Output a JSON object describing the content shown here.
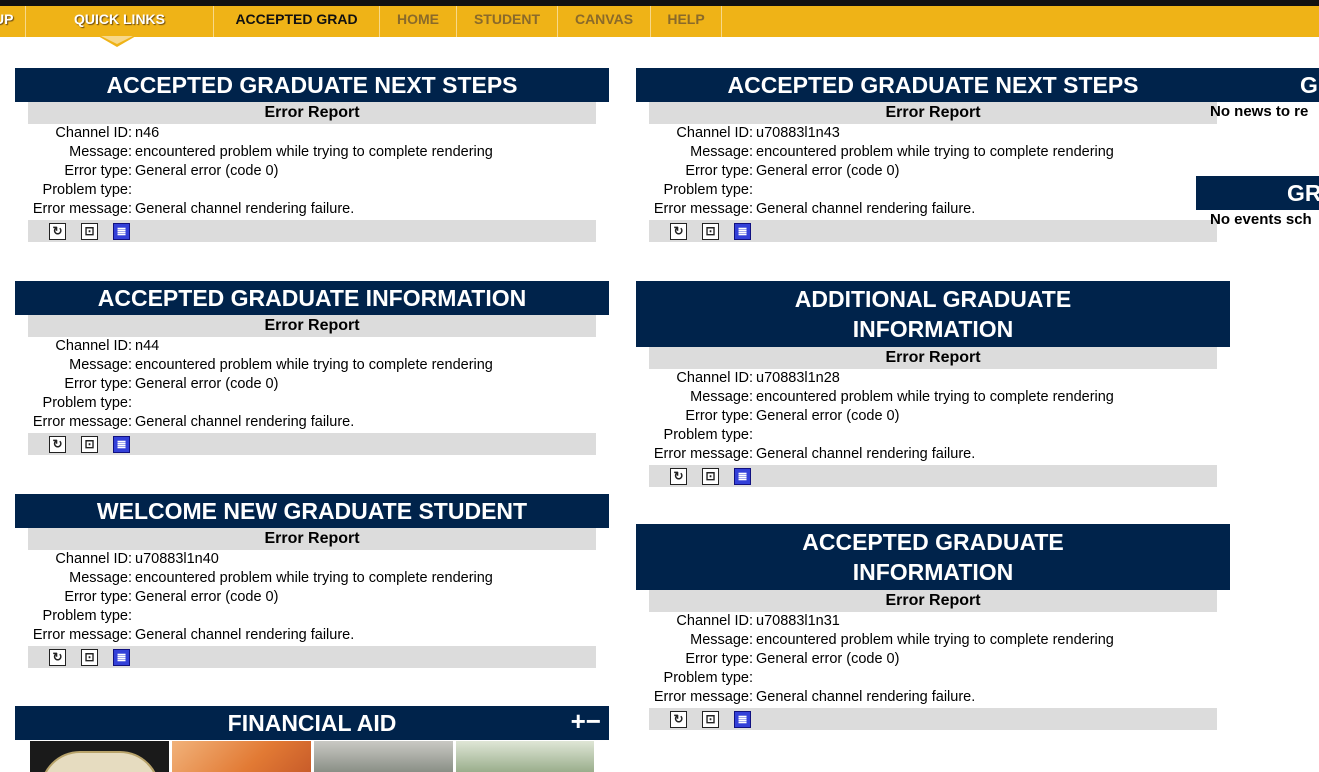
{
  "nav": {
    "items": [
      {
        "label": "UP"
      },
      {
        "label": "QUICK LINKS"
      },
      {
        "label": "ACCEPTED GRAD"
      },
      {
        "label": "HOME"
      },
      {
        "label": "STUDENT"
      },
      {
        "label": "CANVAS"
      },
      {
        "label": "HELP"
      }
    ]
  },
  "error_report_label": "Error Report",
  "field_labels": {
    "channel_id": "Channel ID:",
    "message": "Message:",
    "error_type": "Error type:",
    "problem_type": "Problem type:",
    "error_message": "Error message:"
  },
  "portlets": [
    {
      "title": "ACCEPTED GRADUATE NEXT STEPS",
      "channel_id": "n46",
      "message": "encountered problem while trying to complete rendering",
      "error_type": "General error (code 0)",
      "problem_type": "",
      "error_message": "General channel rendering failure."
    },
    {
      "title": "ACCEPTED GRADUATE INFORMATION",
      "channel_id": "n44",
      "message": "encountered problem while trying to complete rendering",
      "error_type": "General error (code 0)",
      "problem_type": "",
      "error_message": "General channel rendering failure."
    },
    {
      "title": "WELCOME NEW GRADUATE STUDENT",
      "channel_id": "u70883l1n40",
      "message": "encountered problem while trying to complete rendering",
      "error_type": "General error (code 0)",
      "problem_type": "",
      "error_message": "General channel rendering failure."
    },
    {
      "title": "ACCEPTED GRADUATE NEXT STEPS",
      "channel_id": "u70883l1n43",
      "message": "encountered problem while trying to complete rendering",
      "error_type": "General error (code 0)",
      "problem_type": "",
      "error_message": "General channel rendering failure."
    },
    {
      "title_line1": "ADDITIONAL GRADUATE",
      "title_line2": "INFORMATION",
      "channel_id": "u70883l1n28",
      "message": "encountered problem while trying to complete rendering",
      "error_type": "General error (code 0)",
      "problem_type": "",
      "error_message": "General channel rendering failure."
    },
    {
      "title_line1": "ACCEPTED GRADUATE",
      "title_line2": "INFORMATION",
      "channel_id": "u70883l1n31",
      "message": "encountered problem while trying to complete rendering",
      "error_type": "General error (code 0)",
      "problem_type": "",
      "error_message": "General channel rendering failure."
    }
  ],
  "financial_aid": {
    "title": "FINANCIAL AID",
    "controls": "+−"
  },
  "sidebar": {
    "news_title": "G",
    "news_text": "No news to re",
    "events_title": "GR",
    "events_text": "No events sch"
  },
  "icons": [
    "refresh-icon",
    "focus-icon",
    "about-icon"
  ],
  "colors": {
    "nav_bg": "#efb317",
    "title_bg": "#00234b",
    "error_bg": "#dcdcdc",
    "about_icon": "#3340d8"
  }
}
